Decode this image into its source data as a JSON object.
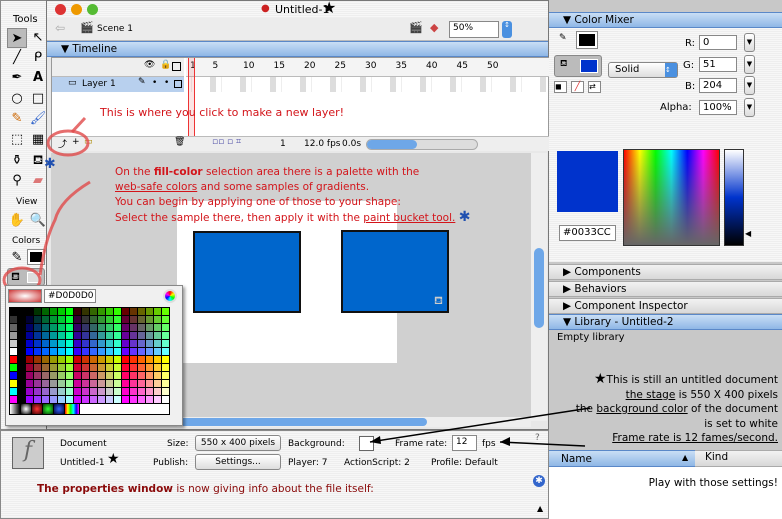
{
  "tools": {
    "title": "Tools",
    "view_label": "View",
    "colors_label": "Colors"
  },
  "window": {
    "title": "Untitled-1",
    "scene": "Scene 1",
    "zoom": "50%"
  },
  "timeline": {
    "title": "Timeline",
    "layer": "Layer 1",
    "frames": [
      "1",
      "5",
      "10",
      "15",
      "20",
      "25",
      "30",
      "35",
      "40",
      "45",
      "50"
    ],
    "current_frame": "1",
    "fps": "12.0 fps",
    "time": "0.0s"
  },
  "annotations": {
    "new_layer": "This is where you click to make a new layer!",
    "fill_1a": "On the ",
    "fill_1b": "fill-color",
    "fill_1c": " selection area there is a palette with the",
    "fill_2a": "web-safe colors",
    "fill_2b": " and some samples of gradients.",
    "fill_3": "You can begin by applying one of those to your shape:",
    "fill_4a": "Select the sample there, then apply it with the ",
    "fill_4b": "paint bucket tool.",
    "right_1": "This is still an untitled document",
    "right_2a": "the stage",
    "right_2b": " is 550 X 400 pixels",
    "right_3a": "the ",
    "right_3b": "background color",
    "right_3c": " of the document",
    "right_4": "is set to white",
    "right_5": "Frame rate is 12 fames/second.",
    "props_a": "The properties window",
    "props_b": " is now giving info about the file itself:",
    "play": "Play with those settings!"
  },
  "palette": {
    "hex": "#D0D0D0"
  },
  "shape_color": "#0066cc",
  "properties": {
    "doc_label": "Document",
    "doc_name": "Untitled-1",
    "size_label": "Size:",
    "size_value": "550 x 400 pixels",
    "background_label": "Background:",
    "background_color": "#ffffff",
    "framerate_label": "Frame rate:",
    "framerate_value": "12",
    "fps_unit": "fps",
    "publish_label": "Publish:",
    "settings_button": "Settings...",
    "player": "Player: 7",
    "actionscript": "ActionScript: 2",
    "profile": "Profile:  Default"
  },
  "color_mixer": {
    "title": "Color Mixer",
    "type": "Solid",
    "r_label": "R:",
    "r": "0",
    "g_label": "G:",
    "g": "51",
    "b_label": "B:",
    "b": "204",
    "alpha_label": "Alpha:",
    "alpha": "100%",
    "hex": "#0033CC"
  },
  "panels": [
    "Components",
    "Behaviors",
    "Component Inspector"
  ],
  "library": {
    "title": "Library - Untitled-2",
    "empty": "Empty library",
    "col_name": "Name",
    "col_kind": "Kind"
  }
}
